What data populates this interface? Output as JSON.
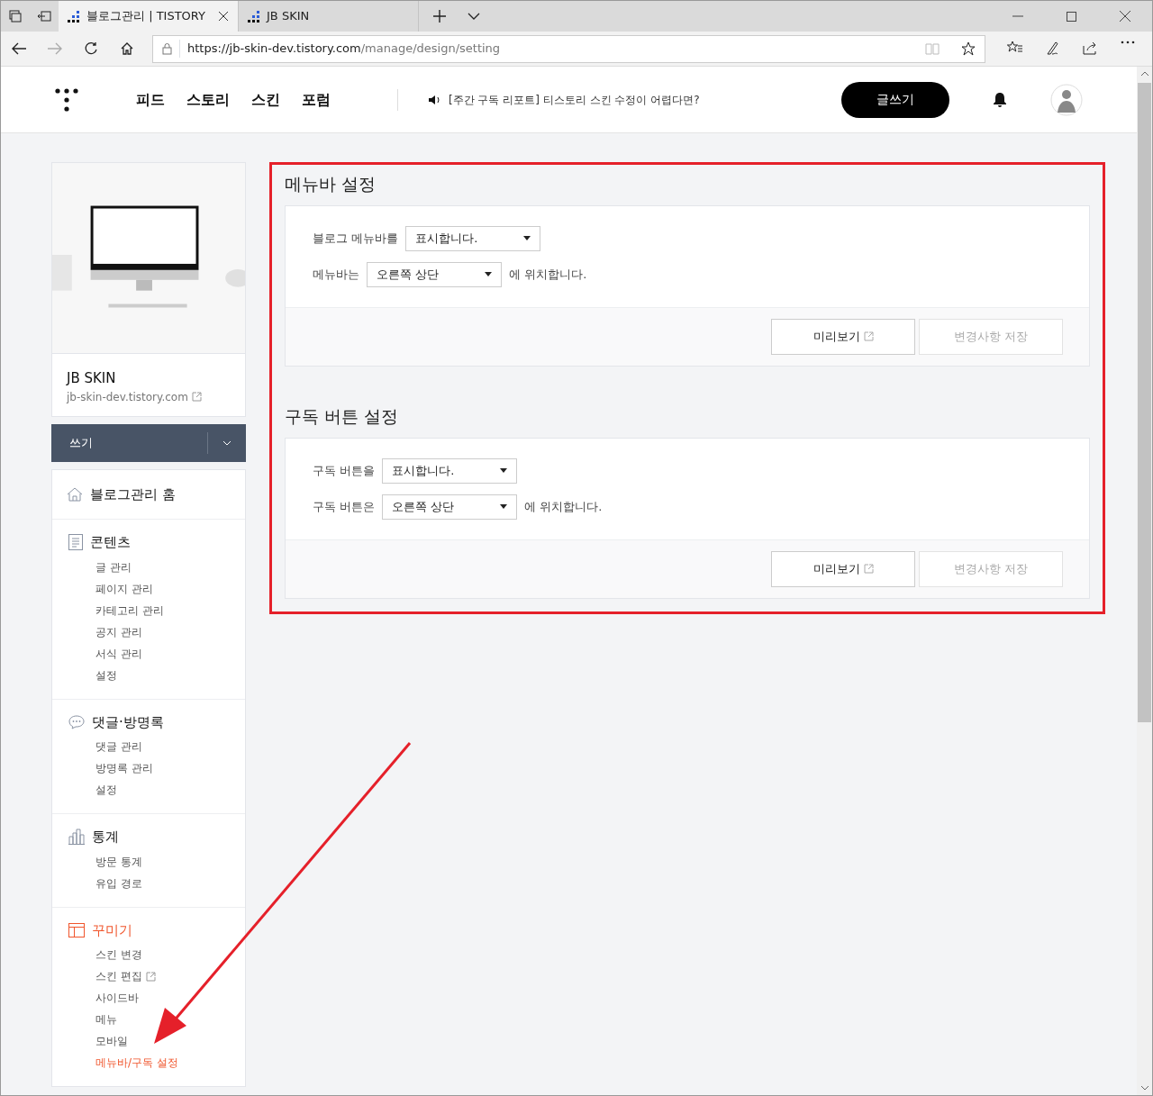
{
  "browser": {
    "tabs": [
      {
        "title": "블로그관리 | TISTORY",
        "selected": true
      },
      {
        "title": "JB SKIN",
        "selected": false
      }
    ],
    "url_host": "https://jb-skin-dev.tistory.com",
    "url_path": "/manage/design/setting"
  },
  "header": {
    "nav": [
      "피드",
      "스토리",
      "스킨",
      "포럼"
    ],
    "notice": "[주간 구독 리포트] 티스토리 스킨 수정이 어렵다면?",
    "write_button": "글쓰기"
  },
  "sidebar": {
    "blog_name": "JB SKIN",
    "blog_url": "jb-skin-dev.tistory.com",
    "write_button": "쓰기",
    "home": "블로그관리 홈",
    "sections": [
      {
        "kind": "contents",
        "title": "콘텐츠",
        "selected": false,
        "items": [
          {
            "label": "글 관리",
            "selected": false,
            "external": false
          },
          {
            "label": "페이지 관리",
            "selected": false,
            "external": false
          },
          {
            "label": "카테고리 관리",
            "selected": false,
            "external": false
          },
          {
            "label": "공지 관리",
            "selected": false,
            "external": false
          },
          {
            "label": "서식 관리",
            "selected": false,
            "external": false
          },
          {
            "label": "설정",
            "selected": false,
            "external": false
          }
        ]
      },
      {
        "kind": "comments",
        "title": "댓글·방명록",
        "selected": false,
        "items": [
          {
            "label": "댓글 관리",
            "selected": false,
            "external": false
          },
          {
            "label": "방명록 관리",
            "selected": false,
            "external": false
          },
          {
            "label": "설정",
            "selected": false,
            "external": false
          }
        ]
      },
      {
        "kind": "stats",
        "title": "통계",
        "selected": false,
        "items": [
          {
            "label": "방문 통계",
            "selected": false,
            "external": false
          },
          {
            "label": "유입 경로",
            "selected": false,
            "external": false
          }
        ]
      },
      {
        "kind": "design",
        "title": "꾸미기",
        "selected": true,
        "items": [
          {
            "label": "스킨 변경",
            "selected": false,
            "external": false
          },
          {
            "label": "스킨 편집",
            "selected": false,
            "external": true
          },
          {
            "label": "사이드바",
            "selected": false,
            "external": false
          },
          {
            "label": "메뉴",
            "selected": false,
            "external": false
          },
          {
            "label": "모바일",
            "selected": false,
            "external": false
          },
          {
            "label": "메뉴바/구독 설정",
            "selected": true,
            "external": false
          }
        ]
      }
    ]
  },
  "settings": [
    {
      "title": "메뉴바 설정",
      "rows": [
        {
          "label": "블로그 메뉴바를",
          "value": "표시합니다."
        },
        {
          "label": "메뉴바는",
          "value": "오른쪽 상단",
          "suffix": "에 위치합니다."
        }
      ],
      "preview_button": "미리보기",
      "save_button": {
        "label": "변경사항 저장",
        "disabled": true
      }
    },
    {
      "title": "구독 버튼 설정",
      "rows": [
        {
          "label": "구독 버튼을",
          "value": "표시합니다."
        },
        {
          "label": "구독 버튼은",
          "value": "오른쪽 상단",
          "suffix": "에 위치합니다."
        }
      ],
      "preview_button": "미리보기",
      "save_button": {
        "label": "변경사항 저장",
        "disabled": true
      }
    }
  ]
}
